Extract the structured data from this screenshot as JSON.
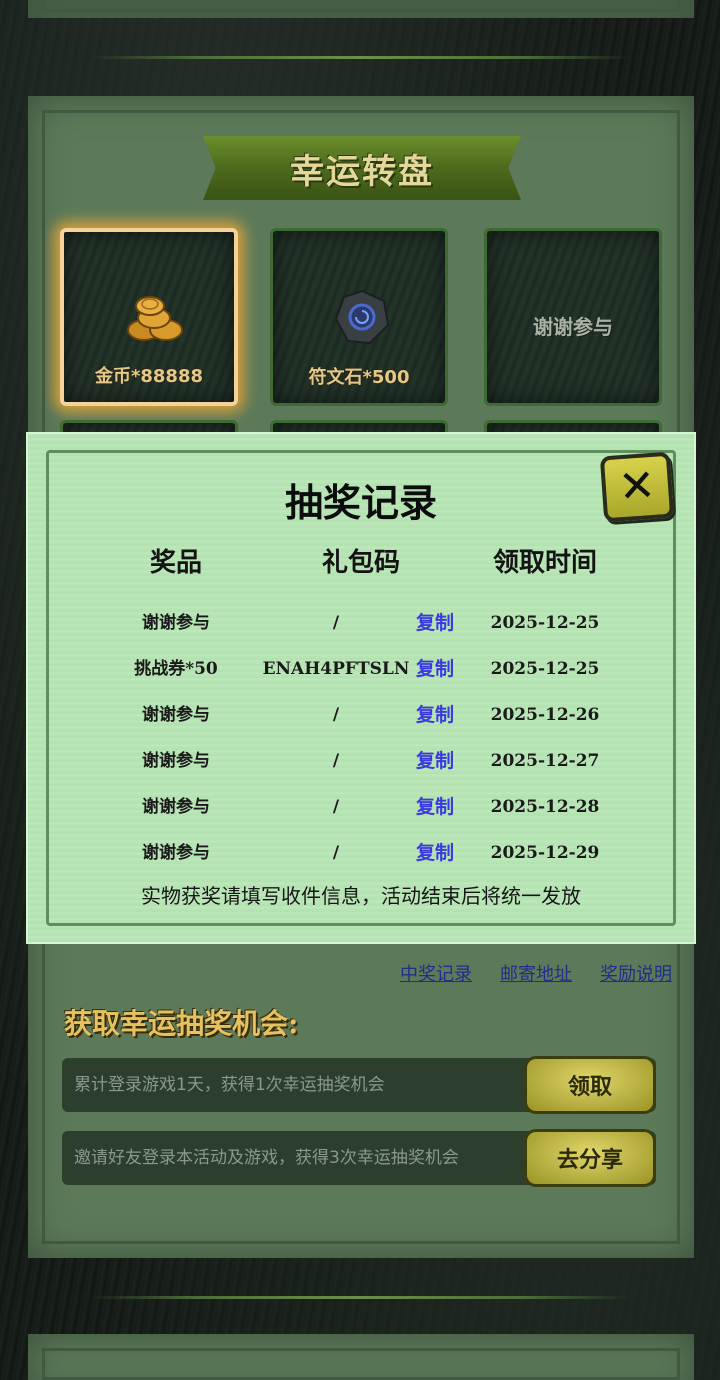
{
  "wheel": {
    "title": "幸运转盘",
    "prizes": [
      {
        "label": "金币*88888",
        "icon": "gold-coins-icon",
        "selected": true
      },
      {
        "label": "符文石*500",
        "icon": "rune-stone-icon",
        "selected": false
      },
      {
        "label": "谢谢参与",
        "icon": "",
        "selected": false
      }
    ]
  },
  "modal": {
    "title": "抽奖记录",
    "headers": {
      "prize": "奖品",
      "code": "礼包码",
      "time": "领取时间"
    },
    "records": [
      {
        "prize": "谢谢参与",
        "code": "/",
        "copy": "复制",
        "date": "2025-12-25"
      },
      {
        "prize": "挑战券*50",
        "code": "ENAH4PFTSLN",
        "copy": "复制",
        "date": "2025-12-25"
      },
      {
        "prize": "谢谢参与",
        "code": "/",
        "copy": "复制",
        "date": "2025-12-26"
      },
      {
        "prize": "谢谢参与",
        "code": "/",
        "copy": "复制",
        "date": "2025-12-27"
      },
      {
        "prize": "谢谢参与",
        "code": "/",
        "copy": "复制",
        "date": "2025-12-28"
      },
      {
        "prize": "谢谢参与",
        "code": "/",
        "copy": "复制",
        "date": "2025-12-29"
      }
    ],
    "note": "实物获奖请填写收件信息，活动结束后将统一发放"
  },
  "links": {
    "records": "中奖记录",
    "address": "邮寄地址",
    "rules": "奖励说明"
  },
  "chances": {
    "title": "获取幸运抽奖机会:",
    "tasks": [
      {
        "text": "累计登录游戏1天，获得1次幸运抽奖机会",
        "button": "领取"
      },
      {
        "text": "邀请好友登录本活动及游戏，获得3次幸运抽奖机会",
        "button": "去分享"
      }
    ]
  },
  "colors": {
    "accent_gold": "#e5c260",
    "modal_bg": "#b9e6b7",
    "link_blue": "#3a3ae0"
  }
}
